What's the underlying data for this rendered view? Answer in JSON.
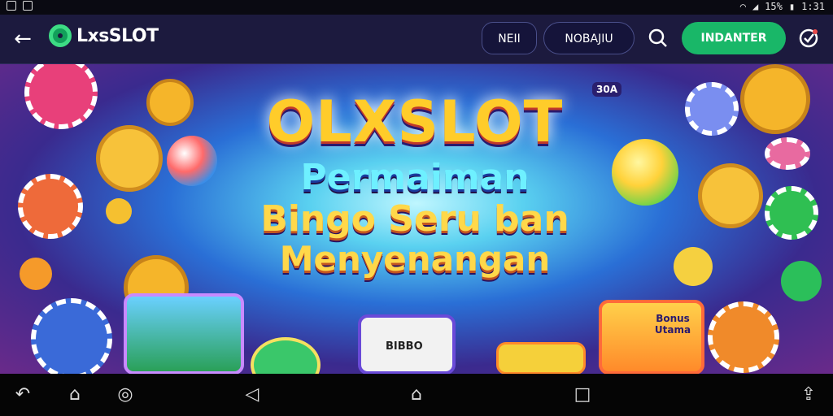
{
  "status_bar": {
    "left_icons": [
      "notification-icon",
      "screenshot-icon"
    ],
    "battery": "15%",
    "time": "1:31"
  },
  "app_bar": {
    "back_icon": "arrow-left-icon",
    "brand": "LxsSLOT",
    "buttons": [
      "NEII",
      "NOBAJIU",
      "INDANTER"
    ],
    "right_icons": [
      "search-icon",
      "shield-check-icon"
    ]
  },
  "banner": {
    "badge": "30A",
    "title": "OLXSLOT",
    "line1": "Permaiman",
    "line2": "Bingo Seru ban",
    "line3": "Menyenangan",
    "card_label": "Bonus Utama",
    "card_text": "BIBBO",
    "fab_icon": "store-icon"
  },
  "nav_bar": {
    "icons": [
      "undo-icon",
      "home-outline-icon",
      "location-icon",
      "back-triangle-icon",
      "home-icon",
      "recents-icon",
      "share-icon"
    ]
  },
  "colors": {
    "appbar_bg": "#1c1a3e",
    "accent_green": "#19b768"
  }
}
